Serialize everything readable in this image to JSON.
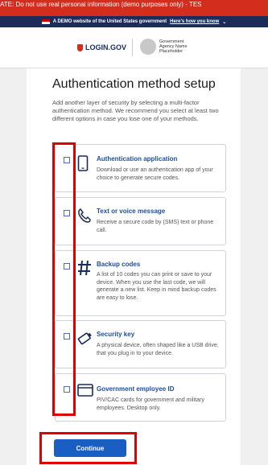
{
  "top_banner": {
    "text": "ATE: Do not use real personal information (demo purposes only) - TES"
  },
  "gov_banner": {
    "text": "A DEMO website of the United States government",
    "link": "Here's how you know"
  },
  "header": {
    "logo_text": "LOGIN.GOV",
    "agency_name": "Government Agency Name Placeholder"
  },
  "page": {
    "title": "Authentication method setup",
    "intro": "Add another layer of security by selecting a multi-factor authentication method. We recommend you select at least two different options in case you lose one of your methods."
  },
  "options": [
    {
      "title": "Authentication application",
      "desc": "Download or use an authentication app of your choice to generate secure codes.",
      "icon": "phone-icon"
    },
    {
      "title": "Text or voice message",
      "desc": "Receive a secure code by (SMS) text or phone call.",
      "icon": "telephone-icon"
    },
    {
      "title": "Backup codes",
      "desc": "A list of 10 codes you can print or save to your device. When you use the last code, we will generate a new list. Keep in mind backup codes are easy to lose.",
      "icon": "hashtag-icon"
    },
    {
      "title": "Security key",
      "desc": "A physical device, often shaped like a USB drive, that you plug in to your device.",
      "icon": "key-icon"
    },
    {
      "title": "Government employee ID",
      "desc": "PIV/CAC cards for government and military employees. Desktop only.",
      "icon": "id-card-icon"
    }
  ],
  "continue_label": "Continue",
  "colors": {
    "accent": "#1a5ec3",
    "title_link": "#1d4fa0",
    "banner": "#d32d1e",
    "highlight": "#e00000"
  }
}
